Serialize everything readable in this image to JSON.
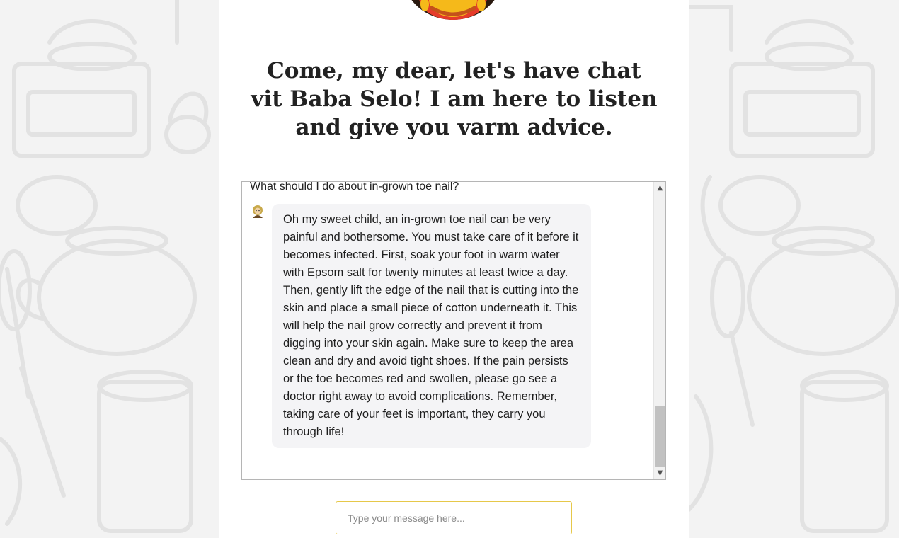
{
  "header": {
    "headline": "Come, my dear, let's have chat vit Baba Selo! I am here to listen and give you varm advice."
  },
  "chat": {
    "messages": [
      {
        "role": "user",
        "text": "What should I do about in-grown toe nail?"
      },
      {
        "role": "assistant",
        "avatar_icon": "grandma-avatar-icon",
        "text": "Oh my sweet child, an in-grown toe nail can be very painful and bothersome. You must take care of it before it becomes infected. First, soak your foot in warm water with Epsom salt for twenty minutes at least twice a day. Then, gently lift the edge of the nail that is cutting into the skin and place a small piece of cotton underneath it. This will help the nail grow correctly and prevent it from digging into your skin again. Make sure to keep the area clean and dry and avoid tight shoes. If the pain persists or the toe becomes red and swollen, please go see a doctor right away to avoid complications. Remember, taking care of your feet is important, they carry you through life!"
      }
    ]
  },
  "composer": {
    "placeholder": "Type your message here..."
  },
  "colors": {
    "input_border": "#e6c84a",
    "bubble_bg": "#f4f4f6",
    "page_bg": "#f4f4f4"
  }
}
